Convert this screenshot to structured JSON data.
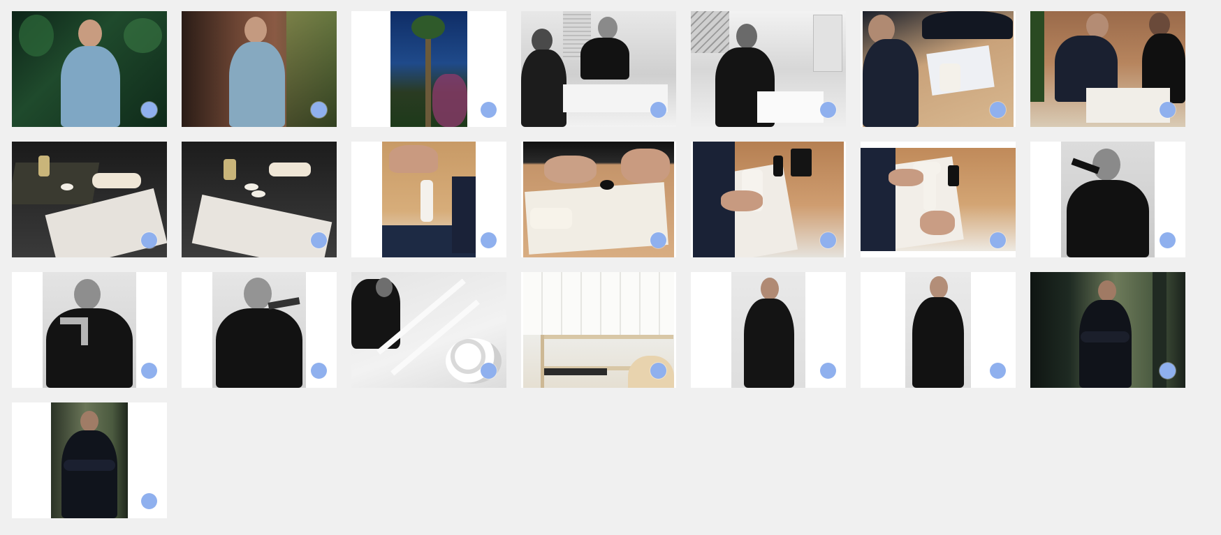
{
  "gallery": {
    "tiles": [
      {
        "id": "t1",
        "scene": "portrait-garden-shirt"
      },
      {
        "id": "t2",
        "scene": "portrait-wall-plant"
      },
      {
        "id": "t3",
        "scene": "palm-tree"
      },
      {
        "id": "t4",
        "scene": "two-at-desk-bw"
      },
      {
        "id": "t5",
        "scene": "drawing-at-desk-bw"
      },
      {
        "id": "t6",
        "scene": "two-discussing-model"
      },
      {
        "id": "t7",
        "scene": "two-reviewing-plans"
      },
      {
        "id": "t8",
        "scene": "table-objects-dark-1"
      },
      {
        "id": "t9",
        "scene": "table-objects-dark-2"
      },
      {
        "id": "t10",
        "scene": "hands-faucet-model"
      },
      {
        "id": "t11",
        "scene": "hand-sketching"
      },
      {
        "id": "t12",
        "scene": "hands-model-table"
      },
      {
        "id": "t13",
        "scene": "hands-faucet-white"
      },
      {
        "id": "t14",
        "scene": "portrait-holding-object"
      },
      {
        "id": "t15",
        "scene": "portrait-faucet-bw"
      },
      {
        "id": "t16",
        "scene": "portrait-faucet-bw-2"
      },
      {
        "id": "t17",
        "scene": "staircase-plates-bw"
      },
      {
        "id": "t18",
        "scene": "interior-shelf"
      },
      {
        "id": "t19",
        "scene": "standing-black-suit"
      },
      {
        "id": "t20",
        "scene": "standing-black-suit-2"
      },
      {
        "id": "t21",
        "scene": "arms-crossed-green"
      },
      {
        "id": "t22",
        "scene": "arms-crossed-green-tall"
      }
    ]
  },
  "colors": {
    "background": "#f0f0f0",
    "tile_background": "#ffffff",
    "select_dot": "#8fb0ee"
  }
}
